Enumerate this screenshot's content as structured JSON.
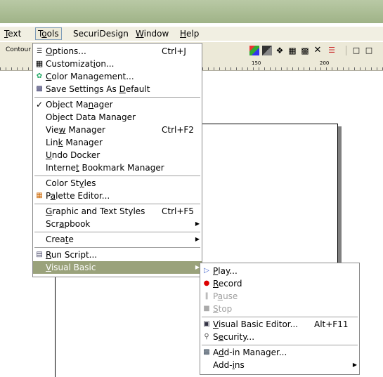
{
  "menubar": {
    "items": [
      "Text",
      "Tools",
      "SecuriDesign",
      "Window",
      "Help"
    ]
  },
  "toolbar": {
    "contour_label": "Contour"
  },
  "ruler": {
    "labels": [
      "150",
      "200"
    ]
  },
  "tools_menu": {
    "items": [
      {
        "label": "Options...",
        "shortcut": "Ctrl+J",
        "icon": "options-icon"
      },
      {
        "label": "Customization...",
        "shortcut": "",
        "icon": "customization-icon"
      },
      {
        "label": "Color Management...",
        "shortcut": "",
        "icon": "color-management-icon"
      },
      {
        "label": "Save Settings As Default",
        "shortcut": "",
        "icon": "save-settings-icon"
      },
      {
        "label": "Object Manager",
        "shortcut": "",
        "icon": "checkmark-icon"
      },
      {
        "label": "Object Data Manager",
        "shortcut": ""
      },
      {
        "label": "View Manager",
        "shortcut": "Ctrl+F2"
      },
      {
        "label": "Link Manager",
        "shortcut": ""
      },
      {
        "label": "Undo Docker",
        "shortcut": ""
      },
      {
        "label": "Internet Bookmark Manager",
        "shortcut": ""
      },
      {
        "label": "Color Styles",
        "shortcut": ""
      },
      {
        "label": "Palette Editor...",
        "shortcut": "",
        "icon": "palette-editor-icon"
      },
      {
        "label": "Graphic and Text Styles",
        "shortcut": "Ctrl+F5"
      },
      {
        "label": "Scrapbook",
        "shortcut": "",
        "submenu": true
      },
      {
        "label": "Create",
        "shortcut": "",
        "submenu": true
      },
      {
        "label": "Run Script...",
        "shortcut": "",
        "icon": "run-script-icon"
      },
      {
        "label": "Visual Basic",
        "shortcut": "",
        "submenu": true,
        "selected": true
      }
    ]
  },
  "vb_menu": {
    "items": [
      {
        "label": "Play...",
        "shortcut": "",
        "icon": "play-icon"
      },
      {
        "label": "Record",
        "shortcut": "",
        "icon": "record-icon"
      },
      {
        "label": "Pause",
        "shortcut": "",
        "icon": "pause-icon",
        "disabled": true
      },
      {
        "label": "Stop",
        "shortcut": "",
        "icon": "stop-icon",
        "disabled": true
      },
      {
        "label": "Visual Basic Editor...",
        "shortcut": "Alt+F11",
        "icon": "vb-editor-icon"
      },
      {
        "label": "Security...",
        "shortcut": "",
        "icon": "key-icon"
      },
      {
        "label": "Add-in Manager...",
        "shortcut": "",
        "icon": "addin-manager-icon"
      },
      {
        "label": "Add-ins",
        "shortcut": "",
        "submenu": true
      }
    ]
  },
  "colors": {
    "selection": "#9aa27b",
    "titlebar": "#a8ba92"
  }
}
